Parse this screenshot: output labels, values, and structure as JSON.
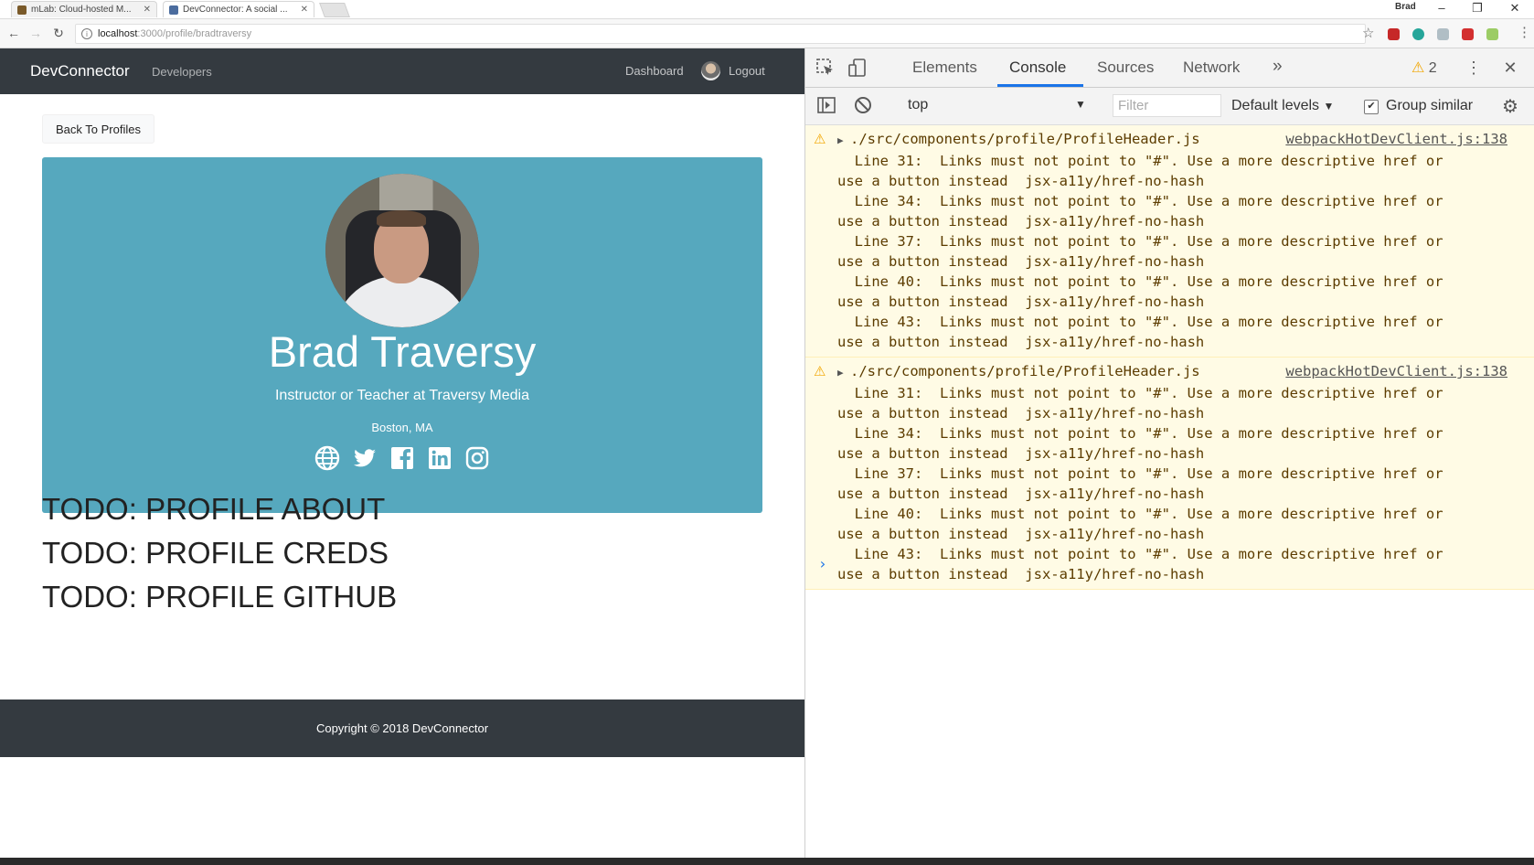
{
  "browser": {
    "tabs": [
      {
        "title": "mLab: Cloud-hosted M...",
        "active": false,
        "favicon_color": "#7a5a2a"
      },
      {
        "title": "DevConnector: A social ...",
        "active": true,
        "favicon_color": "#4b6c9e"
      }
    ],
    "user_badge": "Brad",
    "url_host": "localhost",
    "url_path": ":3000/profile/bradtraversy",
    "window_controls": {
      "minimize": "–",
      "restore": "❐",
      "close": "✕"
    },
    "extension_colors": [
      "#c62828",
      "#26a69a",
      "#90a4ae",
      "#d32f2f",
      "#7cb342"
    ]
  },
  "app": {
    "navbar": {
      "brand": "DevConnector",
      "developers": "Developers",
      "dashboard": "Dashboard",
      "logout": "Logout"
    },
    "back_button": "Back To Profiles",
    "profile": {
      "name": "Brad Traversy",
      "headline": "Instructor or Teacher at Traversy Media",
      "location": "Boston, MA",
      "social_icons": [
        "globe-icon",
        "twitter-icon",
        "facebook-icon",
        "linkedin-icon",
        "instagram-icon"
      ]
    },
    "todos": [
      "TODO: PROFILE ABOUT",
      "TODO: PROFILE CREDS",
      "TODO: PROFILE GITHUB"
    ],
    "footer": "Copyright © 2018 DevConnector",
    "colors": {
      "navbar": "#343a40",
      "card": "#56a8be"
    }
  },
  "devtools": {
    "tabs": [
      "Elements",
      "Console",
      "Sources",
      "Network"
    ],
    "active_tab": "Console",
    "more_tabs": "»",
    "warning_count": "2",
    "context": "top",
    "filter_placeholder": "Filter",
    "levels": "Default levels",
    "group_similar": "Group similar",
    "messages": [
      {
        "file": "./src/components/profile/ProfileHeader.js",
        "source": "webpackHotDevClient.js:138",
        "lines": [
          "  Line 31:  Links must not point to \"#\". Use a more descriptive href or",
          "use a button instead  jsx-a11y/href-no-hash",
          "  Line 34:  Links must not point to \"#\". Use a more descriptive href or",
          "use a button instead  jsx-a11y/href-no-hash",
          "  Line 37:  Links must not point to \"#\". Use a more descriptive href or",
          "use a button instead  jsx-a11y/href-no-hash",
          "  Line 40:  Links must not point to \"#\". Use a more descriptive href or",
          "use a button instead  jsx-a11y/href-no-hash",
          "  Line 43:  Links must not point to \"#\". Use a more descriptive href or",
          "use a button instead  jsx-a11y/href-no-hash"
        ]
      },
      {
        "file": "./src/components/profile/ProfileHeader.js",
        "source": "webpackHotDevClient.js:138",
        "lines": [
          "  Line 31:  Links must not point to \"#\". Use a more descriptive href or",
          "use a button instead  jsx-a11y/href-no-hash",
          "  Line 34:  Links must not point to \"#\". Use a more descriptive href or",
          "use a button instead  jsx-a11y/href-no-hash",
          "  Line 37:  Links must not point to \"#\". Use a more descriptive href or",
          "use a button instead  jsx-a11y/href-no-hash",
          "  Line 40:  Links must not point to \"#\". Use a more descriptive href or",
          "use a button instead  jsx-a11y/href-no-hash",
          "  Line 43:  Links must not point to \"#\". Use a more descriptive href or",
          "use a button instead  jsx-a11y/href-no-hash"
        ]
      }
    ],
    "prompt": "›"
  }
}
